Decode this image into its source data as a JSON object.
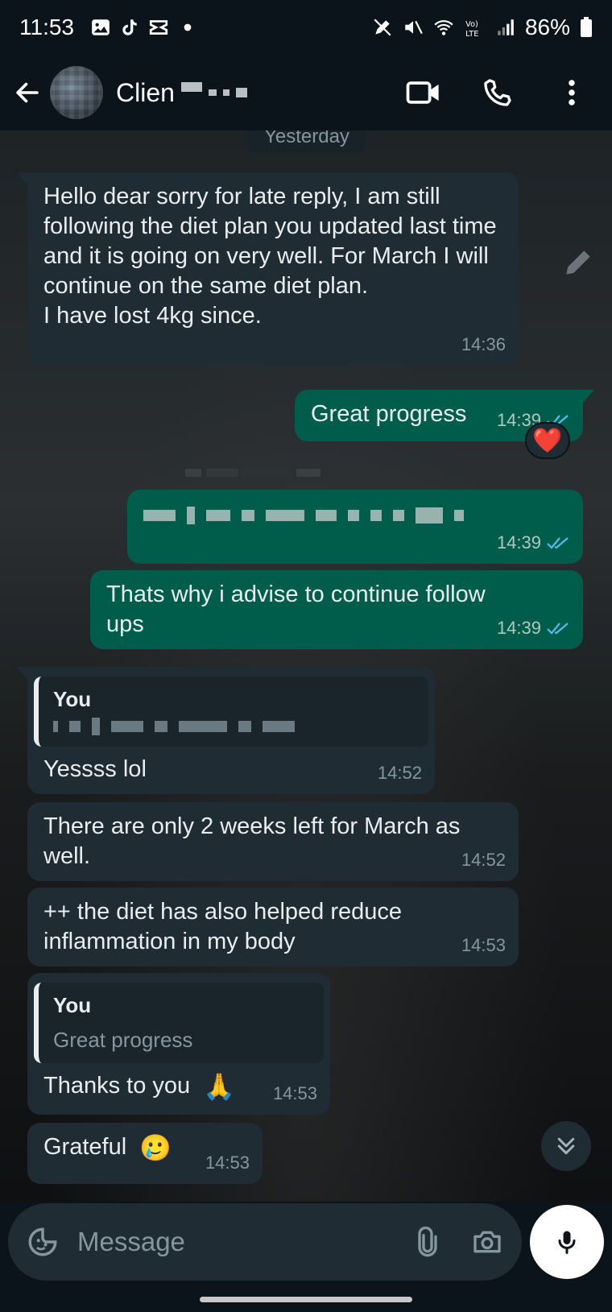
{
  "status_bar": {
    "time": "11:53",
    "battery": "86%",
    "left_icons": [
      "gallery-icon",
      "tiktok-icon",
      "capcut-icon",
      "dot-icon"
    ],
    "right_icons": [
      "no-edit-icon",
      "mute-icon",
      "wifi-icon",
      "volte-icon",
      "signal-icon",
      "battery-icon"
    ]
  },
  "header": {
    "contact_name": "Clien"
  },
  "chat": {
    "date_chip": "Yesterday",
    "messages": [
      {
        "direction": "in",
        "text": "Hello dear sorry for late reply, I am still following the diet plan you updated last time and it is going on very well. For March I will continue on the same diet plan.\nI have lost 4kg since.",
        "time": "14:36"
      },
      {
        "direction": "out",
        "text": "Great progress",
        "time": "14:39",
        "reaction": "❤️"
      },
      {
        "direction": "out",
        "text": "",
        "time": "14:39",
        "redacted": true
      },
      {
        "direction": "out",
        "text": "Thats why i advise to continue follow ups",
        "time": "14:39"
      },
      {
        "direction": "in",
        "quote_name": "You",
        "text": "Yessss lol",
        "time": "14:52"
      },
      {
        "direction": "in",
        "text": "There are only 2 weeks left for March as well.",
        "time": "14:52"
      },
      {
        "direction": "in",
        "text": "++ the diet has also helped reduce inflammation in my body",
        "time": "14:53"
      },
      {
        "direction": "in",
        "quote_name": "You",
        "quote_text": "Great progress",
        "text": "Thanks to you",
        "emoji": "🙏",
        "time": "14:53"
      },
      {
        "direction": "in",
        "text": "Grateful",
        "emoji": "🥲",
        "time": "14:53"
      }
    ]
  },
  "input": {
    "placeholder": "Message"
  },
  "colors": {
    "incoming_bubble": "#1f2c34",
    "outgoing_bubble": "#005c4b",
    "read_tick": "#53bdeb",
    "background": "#0b141a"
  }
}
